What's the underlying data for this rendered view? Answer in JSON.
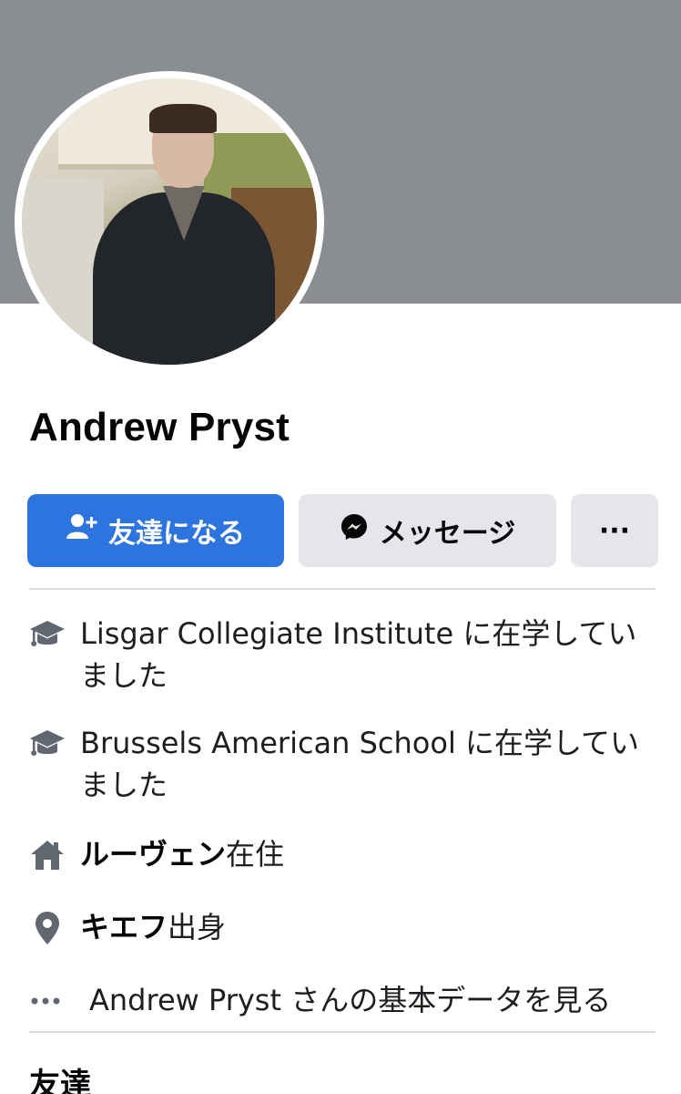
{
  "profile": {
    "name": "Andrew Pryst"
  },
  "actions": {
    "add_friend_label": "友達になる",
    "message_label": "メッセージ",
    "more_label": "···"
  },
  "details": [
    {
      "icon": "graduation-cap-icon",
      "text": "Lisgar Collegiate Institute に在学していました"
    },
    {
      "icon": "graduation-cap-icon",
      "text": "Brussels American School に在学していました"
    },
    {
      "icon": "home-icon",
      "bold": "ルーヴェン",
      "suffix": "在住"
    },
    {
      "icon": "location-pin-icon",
      "bold": "キエフ",
      "suffix": "出身"
    },
    {
      "icon": "more-dots-icon",
      "text": "Andrew Pryst さんの基本データを見る"
    }
  ],
  "sections": {
    "friends_heading": "友達"
  },
  "colors": {
    "cover": "#8a8d91",
    "primary_button": "#2d74de",
    "secondary_button": "#e4e6eb",
    "icon_gray": "#606770"
  }
}
